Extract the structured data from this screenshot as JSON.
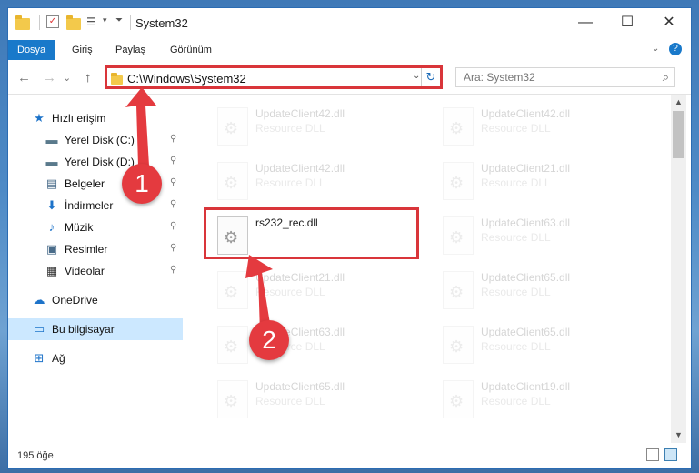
{
  "window": {
    "title": "System32",
    "controls": {
      "minimize": "—",
      "maximize": "☐",
      "close": "✕"
    }
  },
  "ribbon": {
    "tabs": [
      {
        "label": "Dosya",
        "active": true
      },
      {
        "label": "Giriş"
      },
      {
        "label": "Paylaş"
      },
      {
        "label": "Görünüm"
      }
    ],
    "help": "?"
  },
  "nav": {
    "back": "←",
    "forward": "→",
    "up": "↑",
    "recent": "⌄",
    "address": "C:\\Windows\\System32",
    "search_placeholder": "Ara: System32"
  },
  "sidebar": {
    "items": [
      {
        "label": "Hızlı erişim",
        "icon": "star-icon",
        "glyph": "★",
        "color": "#1d73c9"
      },
      {
        "label": "Yerel Disk (C:)",
        "icon": "drive-icon",
        "glyph": "▬",
        "color": "#5a7a8c",
        "pinned": true
      },
      {
        "label": "Yerel Disk (D:)",
        "icon": "drive-icon",
        "glyph": "▬",
        "color": "#5a7a8c",
        "pinned": true
      },
      {
        "label": "Belgeler",
        "icon": "documents-icon",
        "glyph": "▤",
        "color": "#4a6c8a",
        "pinned": true
      },
      {
        "label": "İndirmeler",
        "icon": "downloads-icon",
        "glyph": "⬇",
        "color": "#1d73c9",
        "pinned": true
      },
      {
        "label": "Müzik",
        "icon": "music-icon",
        "glyph": "♪",
        "color": "#1d73c9",
        "pinned": true
      },
      {
        "label": "Resimler",
        "icon": "pictures-icon",
        "glyph": "▣",
        "color": "#4a6c8a",
        "pinned": true
      },
      {
        "label": "Videolar",
        "icon": "videos-icon",
        "glyph": "▦",
        "color": "#333333",
        "pinned": true
      },
      {
        "label": "OneDrive",
        "icon": "onedrive-icon",
        "glyph": "☁",
        "color": "#1d73c9"
      },
      {
        "label": "Bu bilgisayar",
        "icon": "computer-icon",
        "glyph": "▭",
        "color": "#1d73c9",
        "selected": true
      },
      {
        "label": "Ağ",
        "icon": "network-icon",
        "glyph": "⊞",
        "color": "#1d73c9"
      }
    ],
    "pin_glyph": "📌"
  },
  "files": [
    {
      "name": "UpdateClient42.dll",
      "type": "Resource DLL",
      "faded": true
    },
    {
      "name": "UpdateClient42.dll",
      "type": "Resource DLL",
      "faded": true
    },
    {
      "name": "UpdateClient42.dll",
      "type": "Resource DLL",
      "faded": true
    },
    {
      "name": "UpdateClient21.dll",
      "type": "Resource DLL",
      "faded": true
    },
    {
      "name": "rs232_rec.dll",
      "type": "",
      "faded": false
    },
    {
      "name": "UpdateClient63.dll",
      "type": "Resource DLL",
      "faded": true
    },
    {
      "name": "UpdateClient21.dll",
      "type": "Resource DLL",
      "faded": true
    },
    {
      "name": "UpdateClient65.dll",
      "type": "Resource DLL",
      "faded": true
    },
    {
      "name": "UpdateClient63.dll",
      "type": "Resource DLL",
      "faded": true
    },
    {
      "name": "UpdateClient65.dll",
      "type": "Resource DLL",
      "faded": true
    },
    {
      "name": "UpdateClient65.dll",
      "type": "Resource DLL",
      "faded": true
    },
    {
      "name": "UpdateClient19.dll",
      "type": "Resource DLL",
      "faded": true
    }
  ],
  "status": {
    "count": "195 öğe"
  },
  "annotations": {
    "step1": "1",
    "step2": "2",
    "accent": "#e43a3f"
  }
}
